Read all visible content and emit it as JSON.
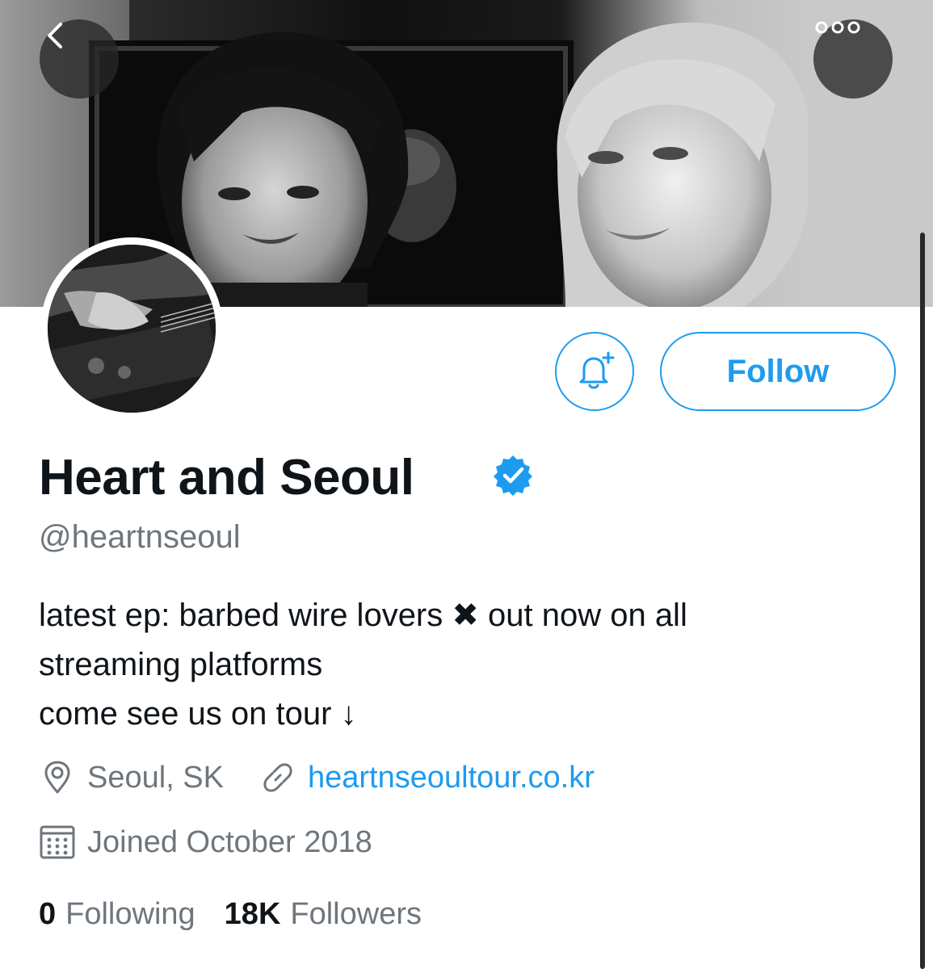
{
  "profile": {
    "display_name": "Heart and Seoul",
    "handle": "@heartnseoul",
    "verified": true,
    "bio_lines": [
      "latest ep: barbed wire lovers ✖ out now on all",
      "streaming platforms",
      "come see us on tour ↓"
    ],
    "location": "Seoul, SK",
    "website": "heartnseoultour.co.kr",
    "joined": "Joined October 2018"
  },
  "actions": {
    "follow_label": "Follow"
  },
  "stats": {
    "following_count": "0",
    "following_label": "Following",
    "followers_count": "18K",
    "followers_label": "Followers"
  },
  "icons": {
    "back": "chevron-left-icon",
    "more": "more-icon",
    "notify": "bell-plus-icon",
    "verified": "verified-badge-icon",
    "location": "location-pin-icon",
    "link": "link-icon",
    "calendar": "calendar-icon"
  },
  "colors": {
    "accent": "#1d9bf0",
    "secondary_text": "#6e767d",
    "primary_text": "#0f1419"
  }
}
